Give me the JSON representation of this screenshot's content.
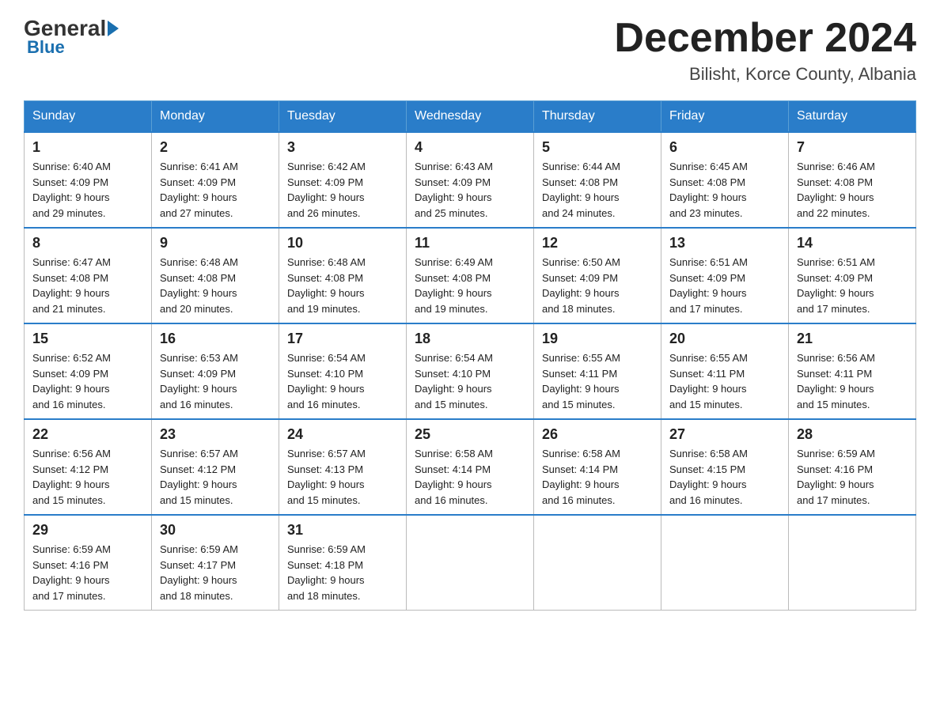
{
  "header": {
    "logo": {
      "general": "General",
      "blue": "Blue"
    },
    "title": "December 2024",
    "location": "Bilisht, Korce County, Albania"
  },
  "days_of_week": [
    "Sunday",
    "Monday",
    "Tuesday",
    "Wednesday",
    "Thursday",
    "Friday",
    "Saturday"
  ],
  "weeks": [
    [
      {
        "day": "1",
        "sunrise": "6:40 AM",
        "sunset": "4:09 PM",
        "daylight": "9 hours and 29 minutes."
      },
      {
        "day": "2",
        "sunrise": "6:41 AM",
        "sunset": "4:09 PM",
        "daylight": "9 hours and 27 minutes."
      },
      {
        "day": "3",
        "sunrise": "6:42 AM",
        "sunset": "4:09 PM",
        "daylight": "9 hours and 26 minutes."
      },
      {
        "day": "4",
        "sunrise": "6:43 AM",
        "sunset": "4:09 PM",
        "daylight": "9 hours and 25 minutes."
      },
      {
        "day": "5",
        "sunrise": "6:44 AM",
        "sunset": "4:08 PM",
        "daylight": "9 hours and 24 minutes."
      },
      {
        "day": "6",
        "sunrise": "6:45 AM",
        "sunset": "4:08 PM",
        "daylight": "9 hours and 23 minutes."
      },
      {
        "day": "7",
        "sunrise": "6:46 AM",
        "sunset": "4:08 PM",
        "daylight": "9 hours and 22 minutes."
      }
    ],
    [
      {
        "day": "8",
        "sunrise": "6:47 AM",
        "sunset": "4:08 PM",
        "daylight": "9 hours and 21 minutes."
      },
      {
        "day": "9",
        "sunrise": "6:48 AM",
        "sunset": "4:08 PM",
        "daylight": "9 hours and 20 minutes."
      },
      {
        "day": "10",
        "sunrise": "6:48 AM",
        "sunset": "4:08 PM",
        "daylight": "9 hours and 19 minutes."
      },
      {
        "day": "11",
        "sunrise": "6:49 AM",
        "sunset": "4:08 PM",
        "daylight": "9 hours and 19 minutes."
      },
      {
        "day": "12",
        "sunrise": "6:50 AM",
        "sunset": "4:09 PM",
        "daylight": "9 hours and 18 minutes."
      },
      {
        "day": "13",
        "sunrise": "6:51 AM",
        "sunset": "4:09 PM",
        "daylight": "9 hours and 17 minutes."
      },
      {
        "day": "14",
        "sunrise": "6:51 AM",
        "sunset": "4:09 PM",
        "daylight": "9 hours and 17 minutes."
      }
    ],
    [
      {
        "day": "15",
        "sunrise": "6:52 AM",
        "sunset": "4:09 PM",
        "daylight": "9 hours and 16 minutes."
      },
      {
        "day": "16",
        "sunrise": "6:53 AM",
        "sunset": "4:09 PM",
        "daylight": "9 hours and 16 minutes."
      },
      {
        "day": "17",
        "sunrise": "6:54 AM",
        "sunset": "4:10 PM",
        "daylight": "9 hours and 16 minutes."
      },
      {
        "day": "18",
        "sunrise": "6:54 AM",
        "sunset": "4:10 PM",
        "daylight": "9 hours and 15 minutes."
      },
      {
        "day": "19",
        "sunrise": "6:55 AM",
        "sunset": "4:11 PM",
        "daylight": "9 hours and 15 minutes."
      },
      {
        "day": "20",
        "sunrise": "6:55 AM",
        "sunset": "4:11 PM",
        "daylight": "9 hours and 15 minutes."
      },
      {
        "day": "21",
        "sunrise": "6:56 AM",
        "sunset": "4:11 PM",
        "daylight": "9 hours and 15 minutes."
      }
    ],
    [
      {
        "day": "22",
        "sunrise": "6:56 AM",
        "sunset": "4:12 PM",
        "daylight": "9 hours and 15 minutes."
      },
      {
        "day": "23",
        "sunrise": "6:57 AM",
        "sunset": "4:12 PM",
        "daylight": "9 hours and 15 minutes."
      },
      {
        "day": "24",
        "sunrise": "6:57 AM",
        "sunset": "4:13 PM",
        "daylight": "9 hours and 15 minutes."
      },
      {
        "day": "25",
        "sunrise": "6:58 AM",
        "sunset": "4:14 PM",
        "daylight": "9 hours and 16 minutes."
      },
      {
        "day": "26",
        "sunrise": "6:58 AM",
        "sunset": "4:14 PM",
        "daylight": "9 hours and 16 minutes."
      },
      {
        "day": "27",
        "sunrise": "6:58 AM",
        "sunset": "4:15 PM",
        "daylight": "9 hours and 16 minutes."
      },
      {
        "day": "28",
        "sunrise": "6:59 AM",
        "sunset": "4:16 PM",
        "daylight": "9 hours and 17 minutes."
      }
    ],
    [
      {
        "day": "29",
        "sunrise": "6:59 AM",
        "sunset": "4:16 PM",
        "daylight": "9 hours and 17 minutes."
      },
      {
        "day": "30",
        "sunrise": "6:59 AM",
        "sunset": "4:17 PM",
        "daylight": "9 hours and 18 minutes."
      },
      {
        "day": "31",
        "sunrise": "6:59 AM",
        "sunset": "4:18 PM",
        "daylight": "9 hours and 18 minutes."
      },
      null,
      null,
      null,
      null
    ]
  ],
  "labels": {
    "sunrise": "Sunrise:",
    "sunset": "Sunset:",
    "daylight": "Daylight:"
  }
}
